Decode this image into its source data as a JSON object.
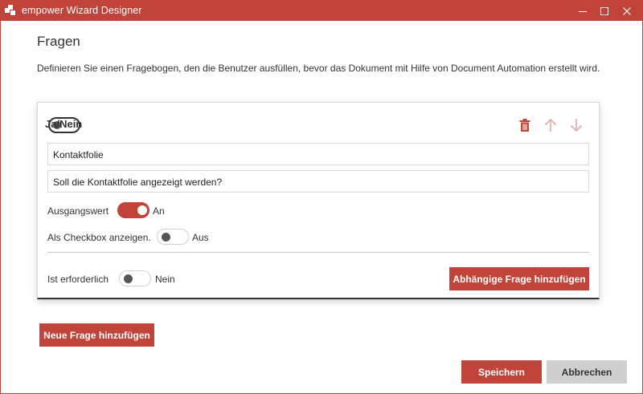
{
  "window": {
    "title": "empower Wizard Designer"
  },
  "page": {
    "title": "Fragen",
    "description": "Definieren Sie einen Fragebogen, den die Benutzer ausfüllen, bevor das Dokument mit Hilfe von Document Automation erstellt wird."
  },
  "question": {
    "type_label": "Ja/Nein",
    "name_value": "Kontaktfolie",
    "text_value": "Soll die Kontaktfolie angezeigt werden?",
    "default": {
      "label": "Ausgangswert",
      "state_label": "An",
      "on": true
    },
    "checkbox": {
      "label": "Als Checkbox anzeigen.",
      "state_label": "Aus",
      "on": false
    },
    "required": {
      "label": "Ist erforderlich",
      "state_label": "Nein",
      "on": false
    },
    "add_dependent_label": "Abhängige Frage hinzufügen"
  },
  "actions": {
    "new_question_label": "Neue Frage hinzufügen",
    "save_label": "Speichern",
    "cancel_label": "Abbrechen"
  },
  "colors": {
    "accent": "#c0443a",
    "secondary_button": "#cfcfcf"
  },
  "icons": {
    "app": "empower-logo-icon",
    "minimize": "minimize-icon",
    "maximize": "maximize-icon",
    "close": "close-icon",
    "delete": "trash-icon",
    "move_up": "arrow-up-icon",
    "move_down": "arrow-down-icon"
  }
}
